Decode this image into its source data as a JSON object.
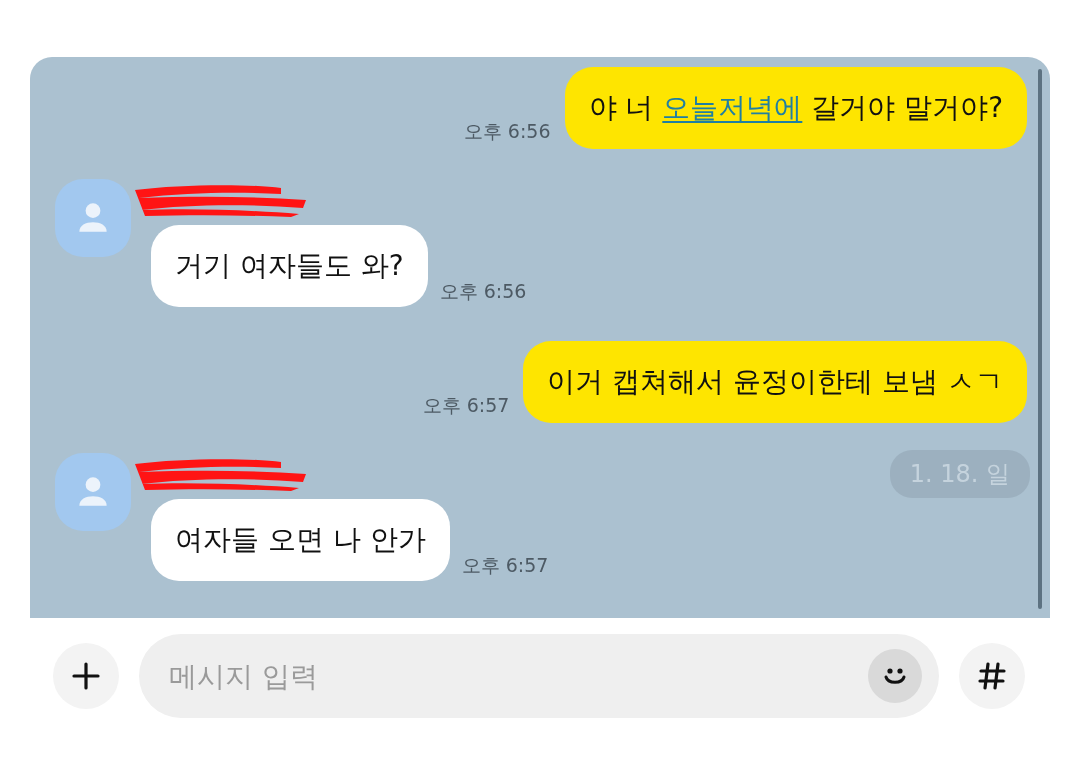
{
  "messages": [
    {
      "kind": "sent",
      "segments": [
        {
          "text": "야 너 ",
          "link": false
        },
        {
          "text": "오늘저녁에",
          "link": true
        },
        {
          "text": " 갈거야 말거야?",
          "link": false
        }
      ],
      "time": "오후 6:56"
    },
    {
      "kind": "received",
      "sender_redacted": true,
      "segments": [
        {
          "text": "거기 여자들도 와?",
          "link": false
        }
      ],
      "time": "오후 6:56"
    },
    {
      "kind": "sent",
      "segments": [
        {
          "text": "이거 캡쳐해서 윤정이한테 보냄 ㅅㄱ",
          "link": false
        }
      ],
      "time": "오후 6:57"
    },
    {
      "kind": "received",
      "sender_redacted": true,
      "segments": [
        {
          "text": "여자들 오면 나 안가",
          "link": false
        }
      ],
      "time": "오후 6:57"
    }
  ],
  "date_badge": "1. 18. 일",
  "composer": {
    "placeholder": "메시지 입력"
  }
}
